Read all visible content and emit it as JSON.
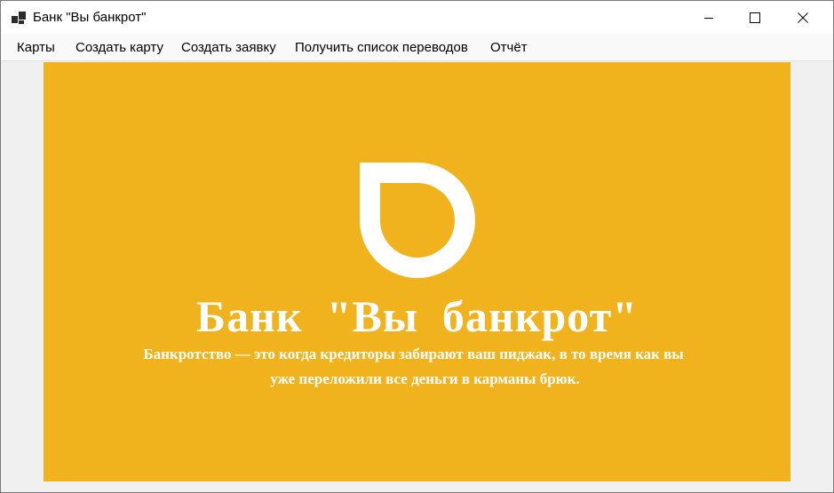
{
  "window": {
    "title": "Банк \"Вы банкрот\""
  },
  "menu": {
    "items": [
      {
        "label": "Карты"
      },
      {
        "label": "Создать карту"
      },
      {
        "label": "Создать заявку"
      },
      {
        "label": "Получить список переводов"
      },
      {
        "label": "Отчёт"
      }
    ]
  },
  "banner": {
    "background_color": "#f1b31d",
    "title": "Банк  \"Вы  банкрот\"",
    "tagline_line1": "Банкротство — это когда кредиторы забирают ваш пиджак, в то время как вы",
    "tagline_line2": "уже переложили все деньги в карманы брюк.",
    "logo_icon": "drop-d-logo-icon"
  }
}
